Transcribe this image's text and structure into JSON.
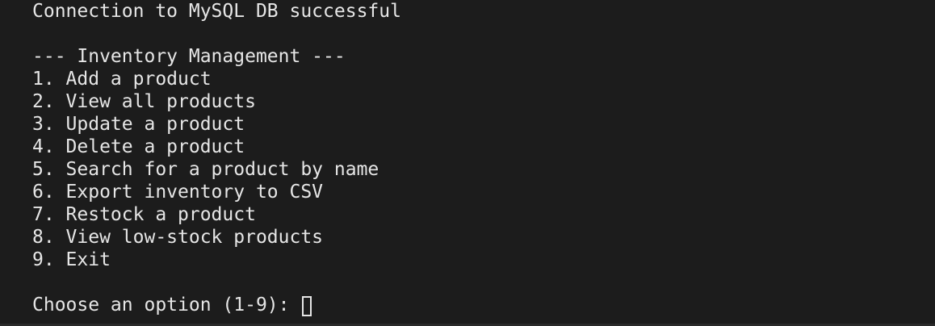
{
  "terminal": {
    "top_fragment": "                                                                 ",
    "connection_message": "Connection to MySQL DB successful",
    "menu_header": "--- Inventory Management ---",
    "menu_items": [
      "1. Add a product",
      "2. View all products",
      "3. Update a product",
      "4. Delete a product",
      "5. Search for a product by name",
      "6. Export inventory to CSV",
      "7. Restock a product",
      "8. View low-stock products",
      "9. Exit"
    ],
    "prompt": "Choose an option (1-9): "
  }
}
